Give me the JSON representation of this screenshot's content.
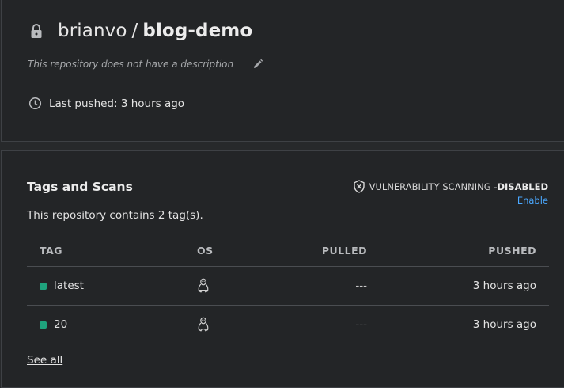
{
  "repo": {
    "owner": "brianvo",
    "separator": "/",
    "name": "blog-demo",
    "description": "This repository does not have a description",
    "last_pushed": "Last pushed: 3 hours ago",
    "lock_icon": "lock-icon",
    "edit_icon": "pencil-icon",
    "clock_icon": "clock-icon"
  },
  "tags": {
    "heading": "Tags and Scans",
    "count_text": "This repository contains 2 tag(s).",
    "vuln_prefix": "VULNERABILITY SCANNING - ",
    "vuln_status": "DISABLED",
    "enable_label": "Enable",
    "columns": [
      "TAG",
      "OS",
      "PULLED",
      "PUSHED"
    ],
    "rows": [
      {
        "tag": "latest",
        "os": "linux-icon",
        "pulled": "---",
        "pushed": "3 hours ago"
      },
      {
        "tag": "20",
        "os": "linux-icon",
        "pulled": "---",
        "pushed": "3 hours ago"
      }
    ],
    "see_all": "See all"
  },
  "colors": {
    "background": "#27292b",
    "card": "#232527",
    "link": "#4aa8ff",
    "tag_dot": "#1fa37d"
  }
}
